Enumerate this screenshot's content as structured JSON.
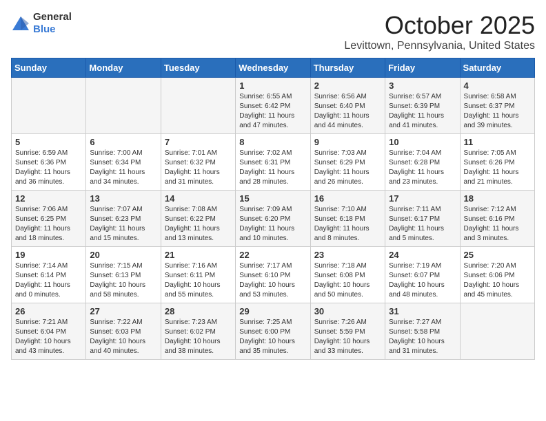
{
  "logo": {
    "general": "General",
    "blue": "Blue"
  },
  "title": "October 2025",
  "location": "Levittown, Pennsylvania, United States",
  "days_of_week": [
    "Sunday",
    "Monday",
    "Tuesday",
    "Wednesday",
    "Thursday",
    "Friday",
    "Saturday"
  ],
  "weeks": [
    [
      {
        "day": "",
        "info": ""
      },
      {
        "day": "",
        "info": ""
      },
      {
        "day": "",
        "info": ""
      },
      {
        "day": "1",
        "info": "Sunrise: 6:55 AM\nSunset: 6:42 PM\nDaylight: 11 hours\nand 47 minutes."
      },
      {
        "day": "2",
        "info": "Sunrise: 6:56 AM\nSunset: 6:40 PM\nDaylight: 11 hours\nand 44 minutes."
      },
      {
        "day": "3",
        "info": "Sunrise: 6:57 AM\nSunset: 6:39 PM\nDaylight: 11 hours\nand 41 minutes."
      },
      {
        "day": "4",
        "info": "Sunrise: 6:58 AM\nSunset: 6:37 PM\nDaylight: 11 hours\nand 39 minutes."
      }
    ],
    [
      {
        "day": "5",
        "info": "Sunrise: 6:59 AM\nSunset: 6:36 PM\nDaylight: 11 hours\nand 36 minutes."
      },
      {
        "day": "6",
        "info": "Sunrise: 7:00 AM\nSunset: 6:34 PM\nDaylight: 11 hours\nand 34 minutes."
      },
      {
        "day": "7",
        "info": "Sunrise: 7:01 AM\nSunset: 6:32 PM\nDaylight: 11 hours\nand 31 minutes."
      },
      {
        "day": "8",
        "info": "Sunrise: 7:02 AM\nSunset: 6:31 PM\nDaylight: 11 hours\nand 28 minutes."
      },
      {
        "day": "9",
        "info": "Sunrise: 7:03 AM\nSunset: 6:29 PM\nDaylight: 11 hours\nand 26 minutes."
      },
      {
        "day": "10",
        "info": "Sunrise: 7:04 AM\nSunset: 6:28 PM\nDaylight: 11 hours\nand 23 minutes."
      },
      {
        "day": "11",
        "info": "Sunrise: 7:05 AM\nSunset: 6:26 PM\nDaylight: 11 hours\nand 21 minutes."
      }
    ],
    [
      {
        "day": "12",
        "info": "Sunrise: 7:06 AM\nSunset: 6:25 PM\nDaylight: 11 hours\nand 18 minutes."
      },
      {
        "day": "13",
        "info": "Sunrise: 7:07 AM\nSunset: 6:23 PM\nDaylight: 11 hours\nand 15 minutes."
      },
      {
        "day": "14",
        "info": "Sunrise: 7:08 AM\nSunset: 6:22 PM\nDaylight: 11 hours\nand 13 minutes."
      },
      {
        "day": "15",
        "info": "Sunrise: 7:09 AM\nSunset: 6:20 PM\nDaylight: 11 hours\nand 10 minutes."
      },
      {
        "day": "16",
        "info": "Sunrise: 7:10 AM\nSunset: 6:18 PM\nDaylight: 11 hours\nand 8 minutes."
      },
      {
        "day": "17",
        "info": "Sunrise: 7:11 AM\nSunset: 6:17 PM\nDaylight: 11 hours\nand 5 minutes."
      },
      {
        "day": "18",
        "info": "Sunrise: 7:12 AM\nSunset: 6:16 PM\nDaylight: 11 hours\nand 3 minutes."
      }
    ],
    [
      {
        "day": "19",
        "info": "Sunrise: 7:14 AM\nSunset: 6:14 PM\nDaylight: 11 hours\nand 0 minutes."
      },
      {
        "day": "20",
        "info": "Sunrise: 7:15 AM\nSunset: 6:13 PM\nDaylight: 10 hours\nand 58 minutes."
      },
      {
        "day": "21",
        "info": "Sunrise: 7:16 AM\nSunset: 6:11 PM\nDaylight: 10 hours\nand 55 minutes."
      },
      {
        "day": "22",
        "info": "Sunrise: 7:17 AM\nSunset: 6:10 PM\nDaylight: 10 hours\nand 53 minutes."
      },
      {
        "day": "23",
        "info": "Sunrise: 7:18 AM\nSunset: 6:08 PM\nDaylight: 10 hours\nand 50 minutes."
      },
      {
        "day": "24",
        "info": "Sunrise: 7:19 AM\nSunset: 6:07 PM\nDaylight: 10 hours\nand 48 minutes."
      },
      {
        "day": "25",
        "info": "Sunrise: 7:20 AM\nSunset: 6:06 PM\nDaylight: 10 hours\nand 45 minutes."
      }
    ],
    [
      {
        "day": "26",
        "info": "Sunrise: 7:21 AM\nSunset: 6:04 PM\nDaylight: 10 hours\nand 43 minutes."
      },
      {
        "day": "27",
        "info": "Sunrise: 7:22 AM\nSunset: 6:03 PM\nDaylight: 10 hours\nand 40 minutes."
      },
      {
        "day": "28",
        "info": "Sunrise: 7:23 AM\nSunset: 6:02 PM\nDaylight: 10 hours\nand 38 minutes."
      },
      {
        "day": "29",
        "info": "Sunrise: 7:25 AM\nSunset: 6:00 PM\nDaylight: 10 hours\nand 35 minutes."
      },
      {
        "day": "30",
        "info": "Sunrise: 7:26 AM\nSunset: 5:59 PM\nDaylight: 10 hours\nand 33 minutes."
      },
      {
        "day": "31",
        "info": "Sunrise: 7:27 AM\nSunset: 5:58 PM\nDaylight: 10 hours\nand 31 minutes."
      },
      {
        "day": "",
        "info": ""
      }
    ]
  ]
}
